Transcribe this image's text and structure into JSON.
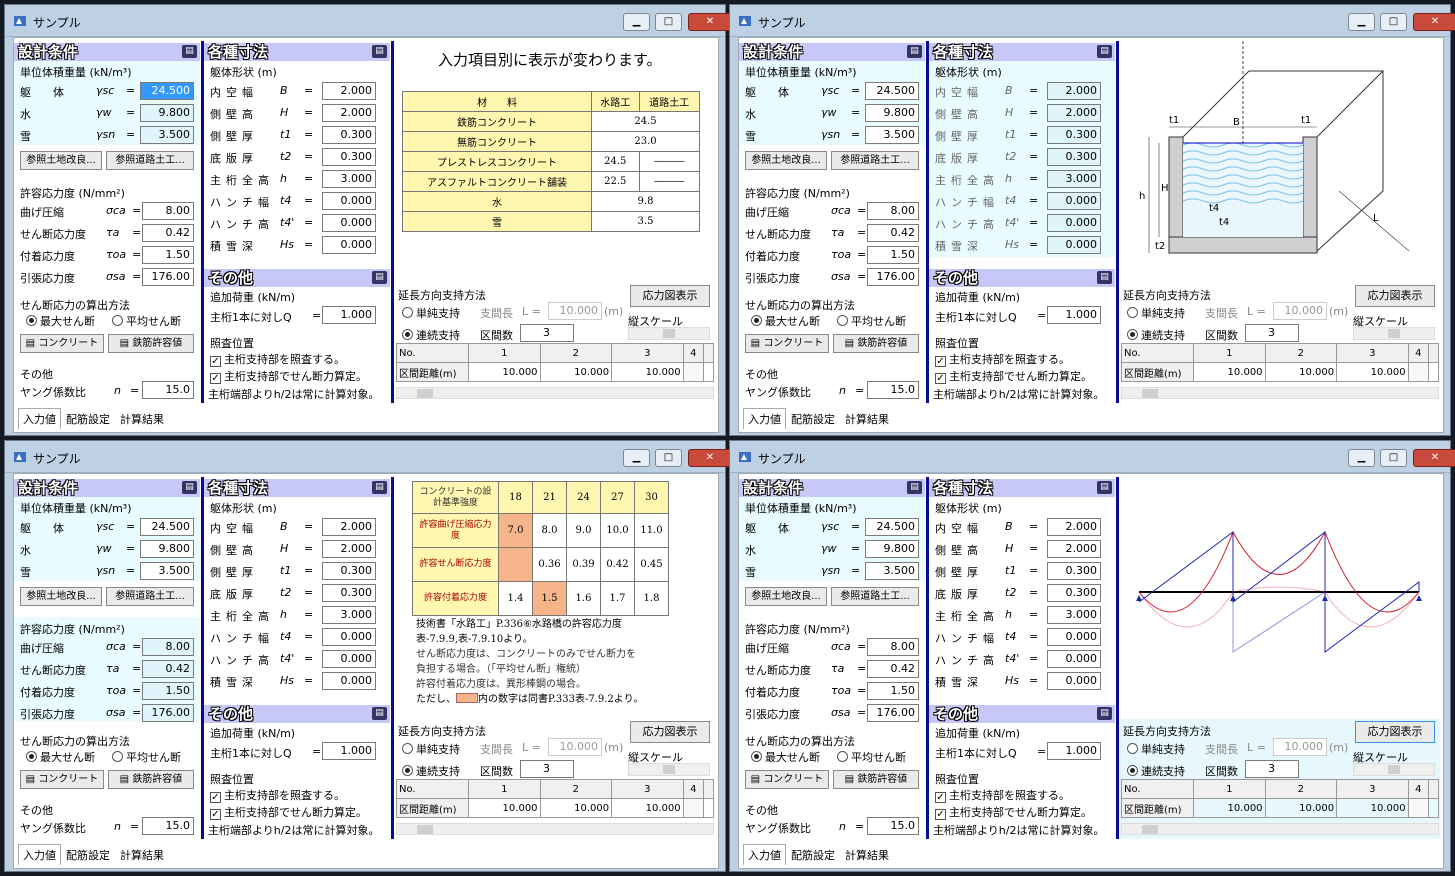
{
  "app": {
    "title": "サンプル"
  },
  "win": {
    "min": "▁",
    "max": "□",
    "close": "✕"
  },
  "s1": {
    "title": "設計条件",
    "unit_w": "単位体積重量 (kN/m³)",
    "rows": [
      {
        "label": "躯　　体",
        "sym": "γsc",
        "val": "24.500"
      },
      {
        "label": "水",
        "sym": "γw",
        "val": "9.800"
      },
      {
        "label": "雪",
        "sym": "γsn",
        "val": "3.500"
      }
    ],
    "btn_soil": "参照土地改良...",
    "btn_road": "参照道路土工...",
    "allow": "許容応力度 (N/mm²)",
    "arows": [
      {
        "label": "曲げ圧縮",
        "sym": "σca",
        "val": "8.00"
      },
      {
        "label": "せん断応力度",
        "sym": "τa",
        "val": "0.42"
      },
      {
        "label": "付着応力度",
        "sym": "τoa",
        "val": "1.50"
      },
      {
        "label": "引張応力度",
        "sym": "σsa",
        "val": "176.00"
      }
    ],
    "shear": "せん断応力の算出方法",
    "r_max": "最大せん断",
    "r_avg": "平均せん断",
    "btn_conc": "コンクリート",
    "btn_rebar": "鉄筋許容値",
    "other": "その他",
    "young": "ヤング係数比",
    "young_sym": "n",
    "young_val": "15.0"
  },
  "s2": {
    "title": "各種寸法",
    "shape": "躯体形状 (m)",
    "rows": [
      {
        "label": "内空幅",
        "sym": "B",
        "val": "2.000"
      },
      {
        "label": "側壁高",
        "sym": "H",
        "val": "2.000"
      },
      {
        "label": "側壁厚",
        "sym": "t1",
        "val": "0.300"
      },
      {
        "label": "底版厚",
        "sym": "t2",
        "val": "0.300"
      },
      {
        "label": "主桁全高",
        "sym": "h",
        "val": "3.000"
      },
      {
        "label": "ハンチ幅",
        "sym": "t4",
        "val": "0.000"
      },
      {
        "label": "ハンチ高",
        "sym": "t4'",
        "val": "0.000"
      },
      {
        "label": "積雪深",
        "sym": "Hs",
        "val": "0.000"
      }
    ],
    "other": "その他",
    "addload": "追加荷重 (kN/m)",
    "perbeam": "主桁1本に対しQ",
    "q_val": "1.000",
    "check": "照査位置",
    "c1": "主桁支持部を照査する。",
    "c2": "主桁支持部でせん断力算定。",
    "note": "主桁端部よりh/2は常に計算対象。"
  },
  "s3": {
    "support": "延長方向支持方法",
    "single": "単純支持",
    "span_len": "支間長",
    "span_sym": "L =",
    "span_val": "10.000",
    "span_unit": "(m)",
    "cont": "連続支持",
    "nspan": "区間数",
    "nspan_val": "3",
    "btn_stress": "応力図表示",
    "vscale": "縦スケール",
    "no": "No.",
    "cols": [
      "1",
      "2",
      "3",
      "4"
    ],
    "dist": "区間距離(m)",
    "dists": [
      "10.000",
      "10.000",
      "10.000"
    ]
  },
  "tabs": [
    "入力値",
    "配筋設定",
    "計算結果"
  ],
  "w1": {
    "caption": "入力項目別に表示が変わります。",
    "mat_head": [
      "材　　料",
      "水路工",
      "道路土工"
    ],
    "mats": [
      [
        "鉄筋コンクリート",
        "24.5"
      ],
      [
        "無筋コンクリート",
        "23.0"
      ],
      [
        "プレストレスコンクリート",
        "24.5",
        "―――"
      ],
      [
        "アスファルトコンクリート舗装",
        "22.5",
        "―――"
      ],
      [
        "水",
        "9.8"
      ],
      [
        "雪",
        "3.5"
      ]
    ]
  },
  "w2": {
    "lbl_B": "B",
    "lbl_t1": "t1",
    "lbl_H": "H",
    "lbl_h": "h",
    "lbl_t4": "t4",
    "lbl_t2": "t2",
    "lbl_L": "L"
  },
  "w3": {
    "head": "コンクリートの設計基準強度",
    "grades": [
      "18",
      "21",
      "24",
      "27",
      "30"
    ],
    "rows": [
      {
        "label": "許容曲げ圧縮応力度",
        "vals": [
          "7.0",
          "8.0",
          "9.0",
          "10.0",
          "11.0"
        ]
      },
      {
        "label": "許容せん断応力度",
        "vals": [
          "",
          "0.36",
          "0.39",
          "0.42",
          "0.45"
        ]
      },
      {
        "label": "許容付着応力度",
        "vals": [
          "1.4",
          "1.5",
          "1.6",
          "1.7",
          "1.8"
        ]
      }
    ],
    "n1": "技術書「水路工」P.336⑥水路橋の許容応力度",
    "n2": "表-7.9.9,表-7.9.10より。",
    "n3": "せん断応力度は、コンクリートのみでせん断力を",
    "n4": "負担する場合。（「平均せん断」権統）",
    "n5": "許容付着応力度は、異形棒鋼の場合。",
    "n6a": "ただし、",
    "n6b": "内の数字は同書P.333表-7.9.2より。"
  },
  "colors": {
    "hl": "#dff5fb",
    "header": "#c8c8f8",
    "sep": "#0a0a9a",
    "orange": "#f5b489",
    "moment": "#d41b2b",
    "shear": "#1c2bb0"
  }
}
